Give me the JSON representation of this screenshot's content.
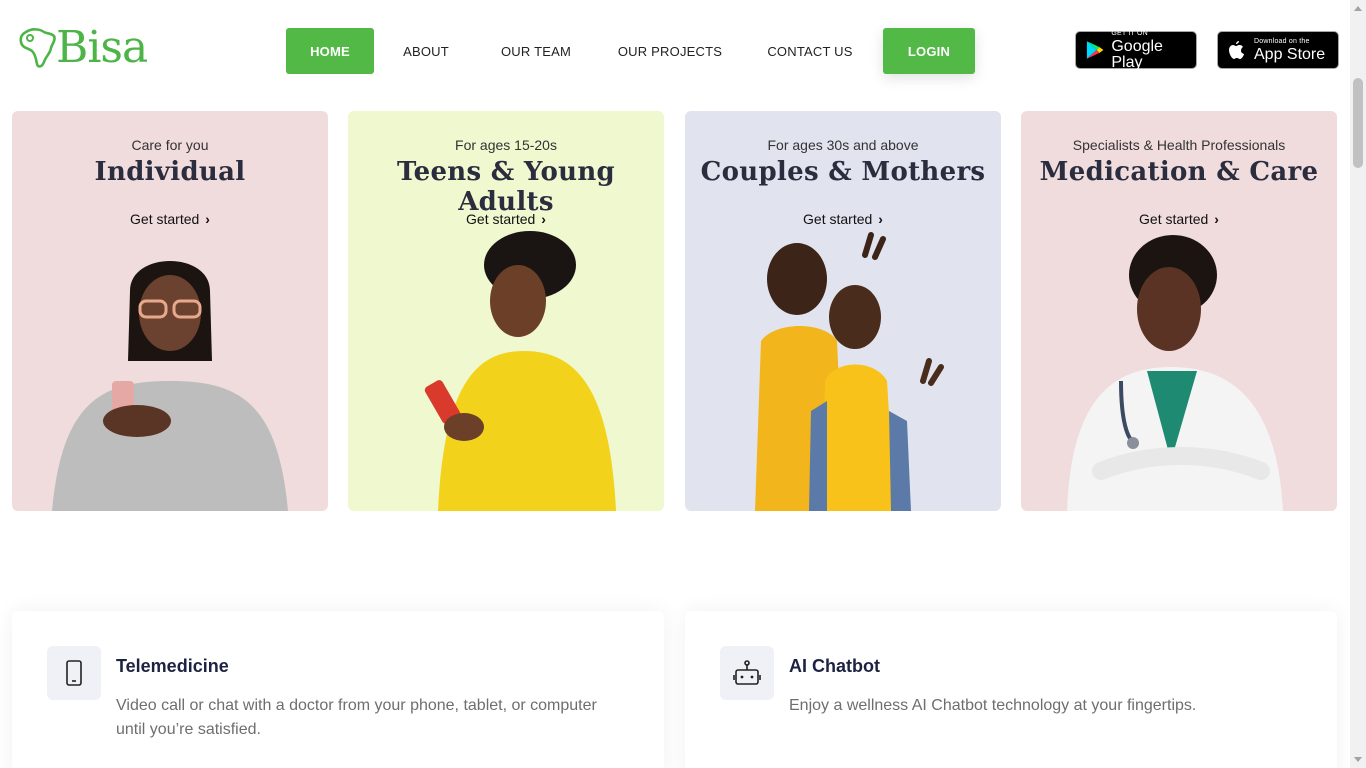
{
  "brand": {
    "name": "Bisa",
    "color": "#4db548"
  },
  "nav": {
    "items": [
      {
        "label": "HOME"
      },
      {
        "label": "ABOUT"
      },
      {
        "label": "OUR TEAM"
      },
      {
        "label": "OUR PROJECTS"
      },
      {
        "label": "CONTACT US"
      }
    ],
    "login": "LOGIN",
    "active": "HOME"
  },
  "stores": {
    "google": {
      "small": "GET IT ON",
      "big": "Google Play"
    },
    "apple": {
      "small": "Download on the",
      "big": "App Store"
    }
  },
  "cards": [
    {
      "sub": "Care for you",
      "title": "Individual",
      "cta": "Get started",
      "chevron": "›",
      "bg": "#f1dcdd"
    },
    {
      "sub": "For ages 15-20s",
      "title": "Teens & Young Adults",
      "cta": "Get started",
      "chevron": "›",
      "bg": "#eff8cf"
    },
    {
      "sub": "For ages 30s and above",
      "title": "Couples & Mothers",
      "cta": "Get started",
      "chevron": "›",
      "bg": "#e1e4ef"
    },
    {
      "sub": "Specialists & Health Professionals",
      "title": "Medication & Care",
      "cta": "Get started",
      "chevron": "›",
      "bg": "#f1dcdd"
    }
  ],
  "features": [
    {
      "icon": "tablet-icon",
      "title": "Telemedicine",
      "desc": "Video call or chat with a doctor from your phone, tablet, or computer until you’re satisfied."
    },
    {
      "icon": "robot-icon",
      "title": "AI Chatbot",
      "desc": "Enjoy a wellness AI Chatbot technology at your fingertips."
    }
  ],
  "colors": {
    "accent": "#52b947",
    "heading": "#2a2d3e"
  }
}
